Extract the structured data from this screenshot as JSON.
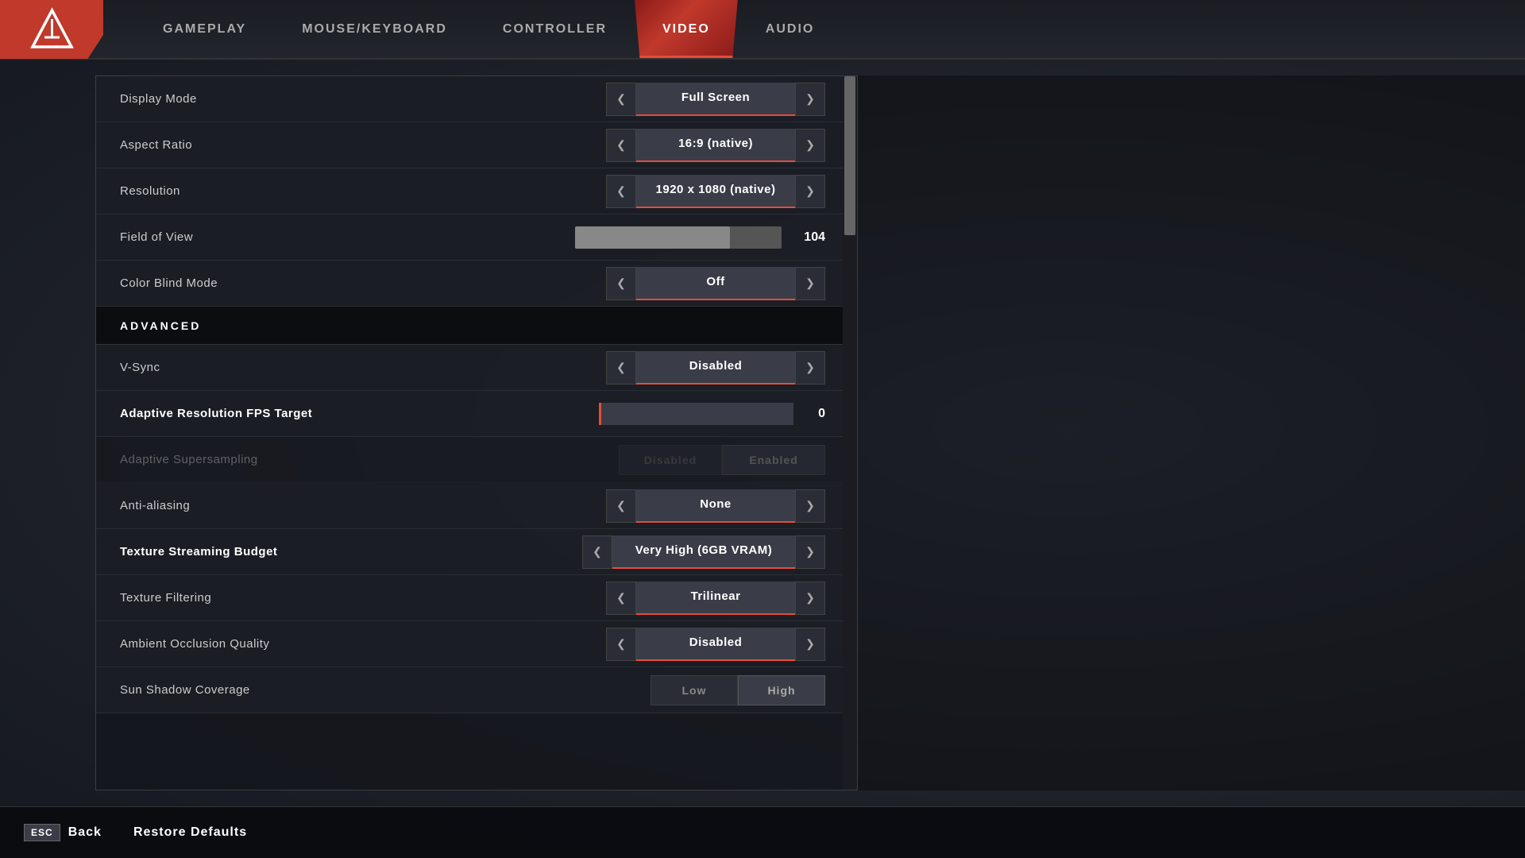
{
  "nav": {
    "tabs": [
      {
        "id": "gameplay",
        "label": "GAMEPLAY",
        "active": false
      },
      {
        "id": "mouse_keyboard",
        "label": "MOUSE/KEYBOARD",
        "active": false
      },
      {
        "id": "controller",
        "label": "CONTROLLER",
        "active": false
      },
      {
        "id": "video",
        "label": "VIDEO",
        "active": true
      },
      {
        "id": "audio",
        "label": "AUDIO",
        "active": false
      }
    ]
  },
  "settings": {
    "basic": [
      {
        "id": "display_mode",
        "label": "Display Mode",
        "value": "Full Screen",
        "type": "selector"
      },
      {
        "id": "aspect_ratio",
        "label": "Aspect Ratio",
        "value": "16:9 (native)",
        "type": "selector"
      },
      {
        "id": "resolution",
        "label": "Resolution",
        "value": "1920 x 1080 (native)",
        "type": "selector"
      },
      {
        "id": "fov",
        "label": "Field of View",
        "value": "104",
        "type": "slider",
        "fill_pct": 75
      },
      {
        "id": "color_blind_mode",
        "label": "Color Blind Mode",
        "value": "Off",
        "type": "selector"
      }
    ],
    "advanced_header": "ADVANCED",
    "advanced": [
      {
        "id": "vsync",
        "label": "V-Sync",
        "value": "Disabled",
        "type": "selector"
      },
      {
        "id": "adaptive_res",
        "label": "Adaptive Resolution FPS Target",
        "value": "0",
        "type": "adaptive_slider"
      },
      {
        "id": "adaptive_supersampling",
        "label": "Adaptive Supersampling",
        "value_left": "Disabled",
        "value_right": "Enabled",
        "type": "toggle",
        "active_side": "left",
        "disabled": true
      },
      {
        "id": "anti_aliasing",
        "label": "Anti-aliasing",
        "value": "None",
        "type": "selector"
      },
      {
        "id": "texture_streaming",
        "label": "Texture Streaming Budget",
        "value": "Very High (6GB VRAM)",
        "type": "selector",
        "bold_label": true
      },
      {
        "id": "texture_filtering",
        "label": "Texture Filtering",
        "value": "Trilinear",
        "type": "selector"
      },
      {
        "id": "ambient_occlusion",
        "label": "Ambient Occlusion Quality",
        "value": "Disabled",
        "type": "selector"
      },
      {
        "id": "sun_shadow_coverage",
        "label": "Sun Shadow Coverage",
        "value_left": "Low",
        "value_right": "High",
        "type": "sun_toggle"
      }
    ]
  },
  "bottom": {
    "esc_label": "ESC",
    "back_label": "Back",
    "restore_label": "Restore Defaults"
  },
  "icons": {
    "arrow_left": "&#10094;",
    "arrow_right": "&#10095;"
  }
}
